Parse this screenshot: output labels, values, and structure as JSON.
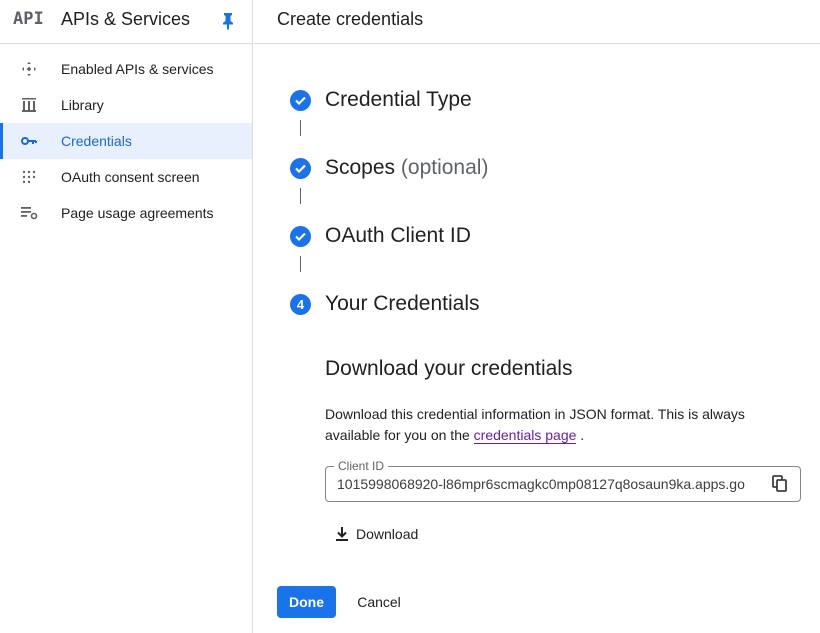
{
  "sidebar": {
    "logo": "API",
    "title": "APIs & Services",
    "items": [
      {
        "label": "Enabled APIs & services",
        "icon": "diamond-arrows-icon"
      },
      {
        "label": "Library",
        "icon": "library-icon"
      },
      {
        "label": "Credentials",
        "icon": "key-icon",
        "active": true
      },
      {
        "label": "OAuth consent screen",
        "icon": "dots-grid-icon"
      },
      {
        "label": "Page usage agreements",
        "icon": "list-settings-icon"
      }
    ]
  },
  "main": {
    "title": "Create credentials",
    "steps": [
      {
        "title": "Credential Type",
        "optional": ""
      },
      {
        "title": "Scopes",
        "optional": "(optional)"
      },
      {
        "title": "OAuth Client ID",
        "optional": ""
      },
      {
        "title": "Your Credentials",
        "number": "4"
      }
    ],
    "download": {
      "title": "Download your credentials",
      "desc_before": "Download this credential information in JSON format. This is always available for you on the ",
      "link_text": "credentials page",
      "desc_after": " .",
      "client_id_label": "Client ID",
      "client_id_value": "1015998068920-l86mpr6scmagkc0mp08127q8osaun9ka.apps.go",
      "download_label": "Download"
    },
    "done_label": "Done",
    "cancel_label": "Cancel"
  },
  "colors": {
    "accent": "#1a73e8",
    "active_bg": "#e8f0fe",
    "link": "#681da8"
  }
}
